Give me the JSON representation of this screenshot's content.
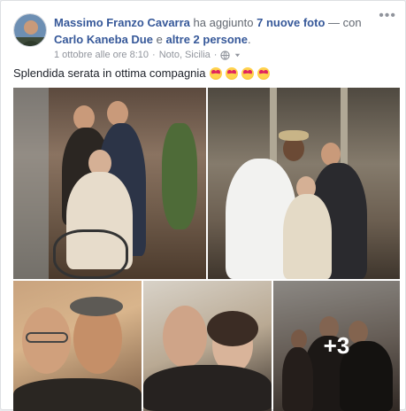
{
  "post": {
    "author": "Massimo Franzo Cavarra",
    "action_text": "ha aggiunto",
    "photos_link": "7 nuove foto",
    "with_text": "— con",
    "tagged_person": "Carlo Kaneba Due",
    "and_text": "e",
    "others_link": "altre 2 persone",
    "period": ".",
    "timestamp": "1 ottobre alle ore 8:10",
    "location": "Noto, Sicilia",
    "caption": "Splendida serata in ottima compagnia",
    "emoji_count": 4,
    "more_photos_label": "+3"
  },
  "colors": {
    "link": "#365899",
    "meta": "#90949c",
    "text": "#1d2129"
  },
  "icons": [
    "more-options-icon",
    "globe-icon",
    "chevron-down-icon",
    "heart-eyes-emoji"
  ]
}
